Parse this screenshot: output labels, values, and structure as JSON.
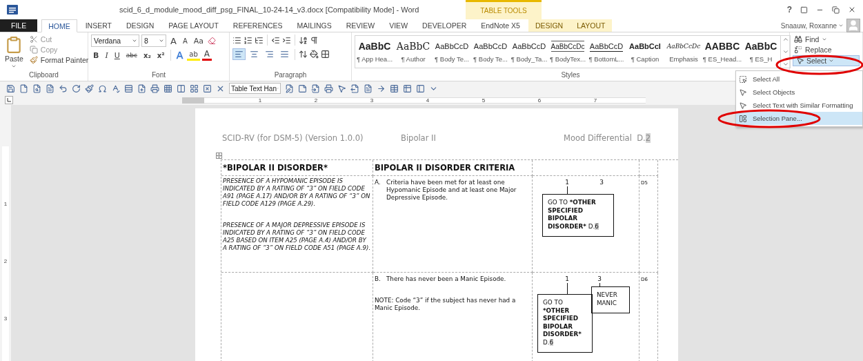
{
  "title_bar": {
    "title": "scid_6_d_module_mood_diff_psg_FINAL_10-24-14_v3.docx [Compatibility Mode] - Word",
    "contextual_group": "TABLE TOOLS",
    "help": "?"
  },
  "ribbon_tabs": [
    {
      "label": "FILE",
      "kind": "file",
      "selected": false
    },
    {
      "label": "HOME",
      "kind": "normal",
      "selected": true
    },
    {
      "label": "INSERT",
      "kind": "normal",
      "selected": false
    },
    {
      "label": "DESIGN",
      "kind": "normal",
      "selected": false
    },
    {
      "label": "PAGE LAYOUT",
      "kind": "normal",
      "selected": false
    },
    {
      "label": "REFERENCES",
      "kind": "normal",
      "selected": false
    },
    {
      "label": "MAILINGS",
      "kind": "normal",
      "selected": false
    },
    {
      "label": "REVIEW",
      "kind": "normal",
      "selected": false
    },
    {
      "label": "VIEW",
      "kind": "normal",
      "selected": false
    },
    {
      "label": "DEVELOPER",
      "kind": "normal",
      "selected": false
    },
    {
      "label": "EndNote X5",
      "kind": "normal",
      "selected": false
    },
    {
      "label": "DESIGN",
      "kind": "contextual",
      "selected": false
    },
    {
      "label": "LAYOUT",
      "kind": "contextual",
      "selected": false
    }
  ],
  "account": {
    "name": "Snaauw, Roxanne"
  },
  "clipboard": {
    "paste": "Paste",
    "cut": "Cut",
    "copy": "Copy",
    "format_painter": "Format Painter",
    "label": "Clipboard"
  },
  "font": {
    "name": "Verdana",
    "size": "8",
    "size_buttons": [
      {
        "label": "A",
        "kind": "grow"
      },
      {
        "label": "A",
        "kind": "shrink"
      },
      {
        "label": "Aa",
        "kind": "case"
      }
    ],
    "format_buttons": [
      {
        "label": "B",
        "kind": "bold"
      },
      {
        "label": "I",
        "kind": "italic"
      },
      {
        "label": "U",
        "kind": "underline"
      },
      {
        "label": "abc",
        "kind": "strike"
      },
      {
        "label": "x₂",
        "kind": "sub"
      },
      {
        "label": "x²",
        "kind": "sup"
      }
    ],
    "color_buttons": [
      {
        "label": "A",
        "kind": "effects"
      },
      {
        "label": "ab",
        "kind": "highlight"
      },
      {
        "label": "A",
        "kind": "color"
      }
    ],
    "label": "Font"
  },
  "paragraph": {
    "alignments": [
      {
        "kind": "left",
        "selected": true
      },
      {
        "kind": "center",
        "selected": false
      },
      {
        "kind": "right",
        "selected": false
      },
      {
        "kind": "justify",
        "selected": false
      }
    ],
    "label": "Paragraph"
  },
  "styles": {
    "label": "Styles",
    "items": [
      {
        "preview": "AaBbC",
        "name": "¶ App Hea...",
        "kind": "heading"
      },
      {
        "preview": "AaBbC",
        "name": "¶ Author",
        "kind": "large"
      },
      {
        "preview": "AaBbCcD",
        "name": "¶ Body Te...",
        "kind": "plain"
      },
      {
        "preview": "AaBbCcD",
        "name": "¶ Body Te...",
        "kind": "plain"
      },
      {
        "preview": "AaBbCcD",
        "name": "¶ Body_Ta...",
        "kind": "plain"
      },
      {
        "preview": "AaBbCcDc",
        "name": "¶ BodyTex...",
        "kind": "boxed"
      },
      {
        "preview": "AaBbCcD",
        "name": "¶ BottomL...",
        "kind": "underlined"
      },
      {
        "preview": "AaBbCcI",
        "name": "¶ Caption",
        "kind": "bold"
      },
      {
        "preview": "AaBbCcDc",
        "name": "Emphasis",
        "kind": "italic"
      },
      {
        "preview": "AABBC",
        "name": "¶ ES_Head...",
        "kind": "caps"
      },
      {
        "preview": "AaBbC",
        "name": "¶ ES_H",
        "kind": "heading"
      }
    ]
  },
  "editing": {
    "find": "Find",
    "replace": "Replace",
    "select": "Select",
    "select_open": true
  },
  "quick_toolbar": {
    "style_box": "Table Text Han"
  },
  "ruler": {
    "numbers": [
      "1",
      "2",
      "3",
      "4",
      "5",
      "6",
      "7"
    ]
  },
  "vertical_ruler": {
    "numbers": [
      "1",
      "2",
      "3"
    ]
  },
  "document": {
    "header": {
      "left": "SCID-RV (for DSM-5) (Version 1.0.0)",
      "center": "Bipolar II",
      "right": "Mood Differential",
      "page_prefix": "D.",
      "page_number": "2"
    },
    "table": {
      "headers": [
        "*BIPOLAR II DISORDER*",
        "BIPOLAR II DISORDER CRITERIA"
      ],
      "rows": [
        {
          "instructions": [
            "PRESENCE OF A HYPOMANIC EPISODE IS INDICATED BY A RATING OF “3” ON FIELD CODE A91 (PAGE A.17) AND/OR BY A RATING OF “3” ON FIELD CODE A129 (PAGE A.29).",
            "PRESENCE OF A MAJOR DEPRESSIVE EPISODE IS INDICATED BY A RATING OF “3” ON FIELD CODE A25 BASED ON ITEM A25 (PAGE A.4) AND/OR BY A RATING OF “3” ON FIELD CODE A51 (PAGE A.9)."
          ],
          "criterion": {
            "letter": "A.",
            "text": "Criteria have been met for at least one Hypomanic Episode and at least one Major Depressive Episode."
          },
          "ratings": [
            {
              "value": "1",
              "box": {
                "lead": "GO TO",
                "target": "*OTHER SPECIFIED BIPOLAR DISORDER*",
                "page_prefix": "D.",
                "page_number": "6"
              }
            },
            {
              "value": "3"
            }
          ],
          "code": "D5"
        },
        {
          "criterion": {
            "letter": "B.",
            "text": "There has never been a Manic Episode."
          },
          "note": "NOTE:  Code “3” if the subject has never had a Manic Episode.",
          "ratings": [
            {
              "value": "1",
              "box": {
                "lead": "GO TO",
                "target": "*OTHER SPECIFIED BIPOLAR DISORDER*",
                "page_prefix": "D.",
                "page_number": "6"
              }
            },
            {
              "value": "3",
              "box": {
                "lead": "NEVER MANIC"
              }
            }
          ],
          "code": "D6"
        }
      ]
    }
  },
  "select_menu": {
    "items": [
      {
        "label": "Select All",
        "kind": "all",
        "selected": false
      },
      {
        "label": "Select Objects",
        "kind": "objects",
        "selected": false
      },
      {
        "label": "Select Text with Similar Formatting",
        "kind": "similar",
        "selected": false
      },
      {
        "label": "Selection Pane...",
        "kind": "pane",
        "selected": true
      }
    ]
  }
}
